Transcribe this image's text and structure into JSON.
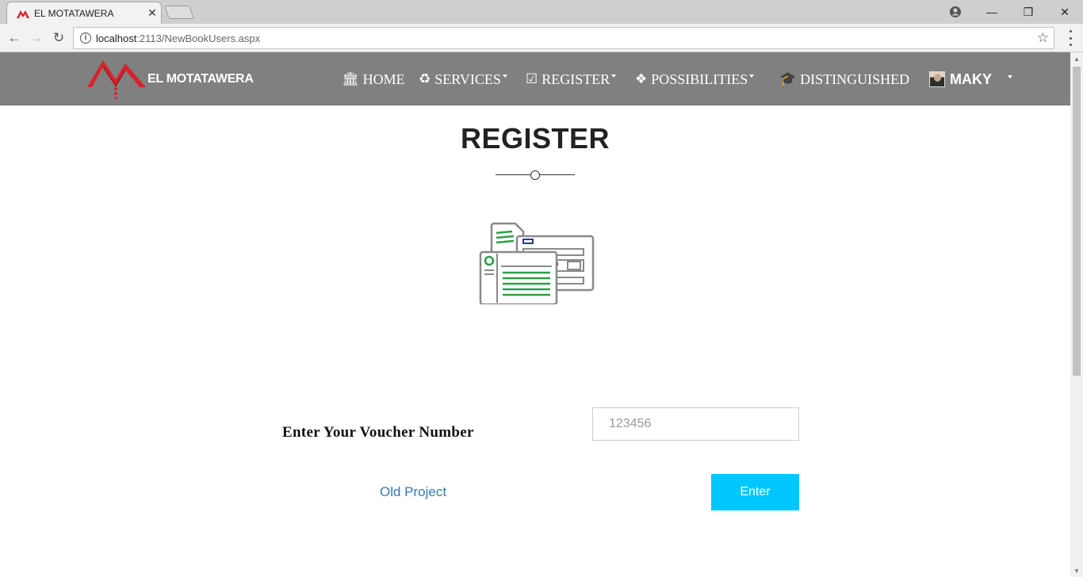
{
  "browser": {
    "tab_title": "EL MOTATAWERA",
    "tab_close": "✕",
    "url_host": "localhost",
    "url_rest": ":2113/NewBookUsers.aspx",
    "info_glyph": "i",
    "star_glyph": "☆",
    "back_glyph": "←",
    "forward_glyph": "→",
    "reload_glyph": "↻",
    "account_glyph": "●",
    "minimize_glyph": "—",
    "restore_glyph": "❐",
    "close_glyph": "✕",
    "icons": [
      "back-arrow-icon",
      "forward-arrow-icon",
      "reload-icon",
      "info-icon",
      "star-icon",
      "menu-dots-icon",
      "account-icon",
      "minimize-icon",
      "restore-icon",
      "close-icon"
    ]
  },
  "navbar": {
    "brand": "EL MOTATAWERA",
    "items": [
      {
        "label": "HOME",
        "icon": "🏛",
        "icon_name": "bank-icon"
      },
      {
        "label": "SERVICES",
        "icon": "♻",
        "icon_name": "recycle-icon"
      },
      {
        "label": "REGISTER",
        "icon": "☑",
        "icon_name": "checkbox-icon"
      },
      {
        "label": "POSSIBILITIES",
        "icon": "❖",
        "icon_name": "cubes-icon"
      },
      {
        "label": "DISTINGUISHED",
        "icon": "🎓",
        "icon_name": "graduation-cap-icon"
      }
    ],
    "user": {
      "name": "MAKY"
    }
  },
  "main": {
    "heading": "REGISTER",
    "voucher_label": "Enter Your Voucher Number",
    "voucher_placeholder": "123456",
    "old_project_link": "Old Project",
    "enter_button": "Enter"
  },
  "colors": {
    "navbar_bg": "#808080",
    "accent_button": "#00c8ff",
    "link": "#337ab7",
    "logo_red": "#d8232a",
    "illustration_green": "#2e9e4a",
    "illustration_gray": "#8a8a8a",
    "illustration_blue": "#2b3a8f"
  }
}
